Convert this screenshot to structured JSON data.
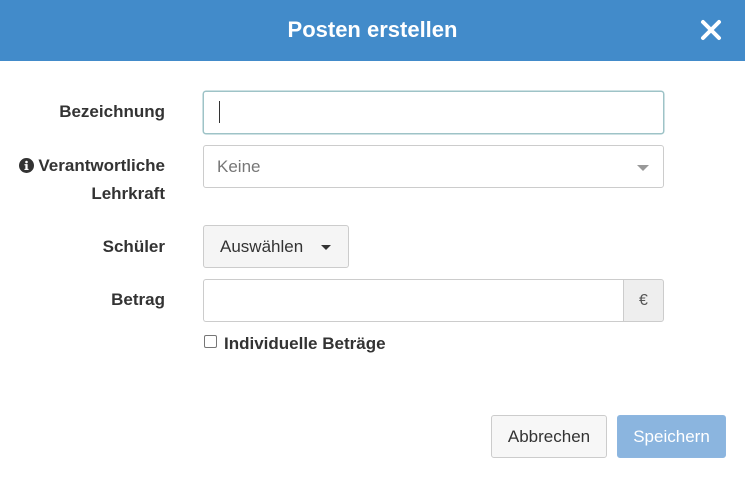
{
  "dialog": {
    "title": "Posten erstellen",
    "close_icon": "close-icon"
  },
  "form": {
    "name": {
      "label": "Bezeichnung",
      "value": ""
    },
    "teacher": {
      "label_line1": "Verantwortliche",
      "label_line2": "Lehrkraft",
      "info_icon": "info-circle-icon",
      "selected": "Keine"
    },
    "students": {
      "label": "Schüler",
      "button_label": "Auswählen"
    },
    "amount": {
      "label": "Betrag",
      "value": "",
      "currency": "€"
    },
    "individual_amounts": {
      "label": "Individuelle Beträge",
      "checked": false
    }
  },
  "footer": {
    "cancel_label": "Abbrechen",
    "save_label": "Speichern"
  },
  "colors": {
    "header": "#428bca",
    "save_button": "#8bb5df"
  }
}
